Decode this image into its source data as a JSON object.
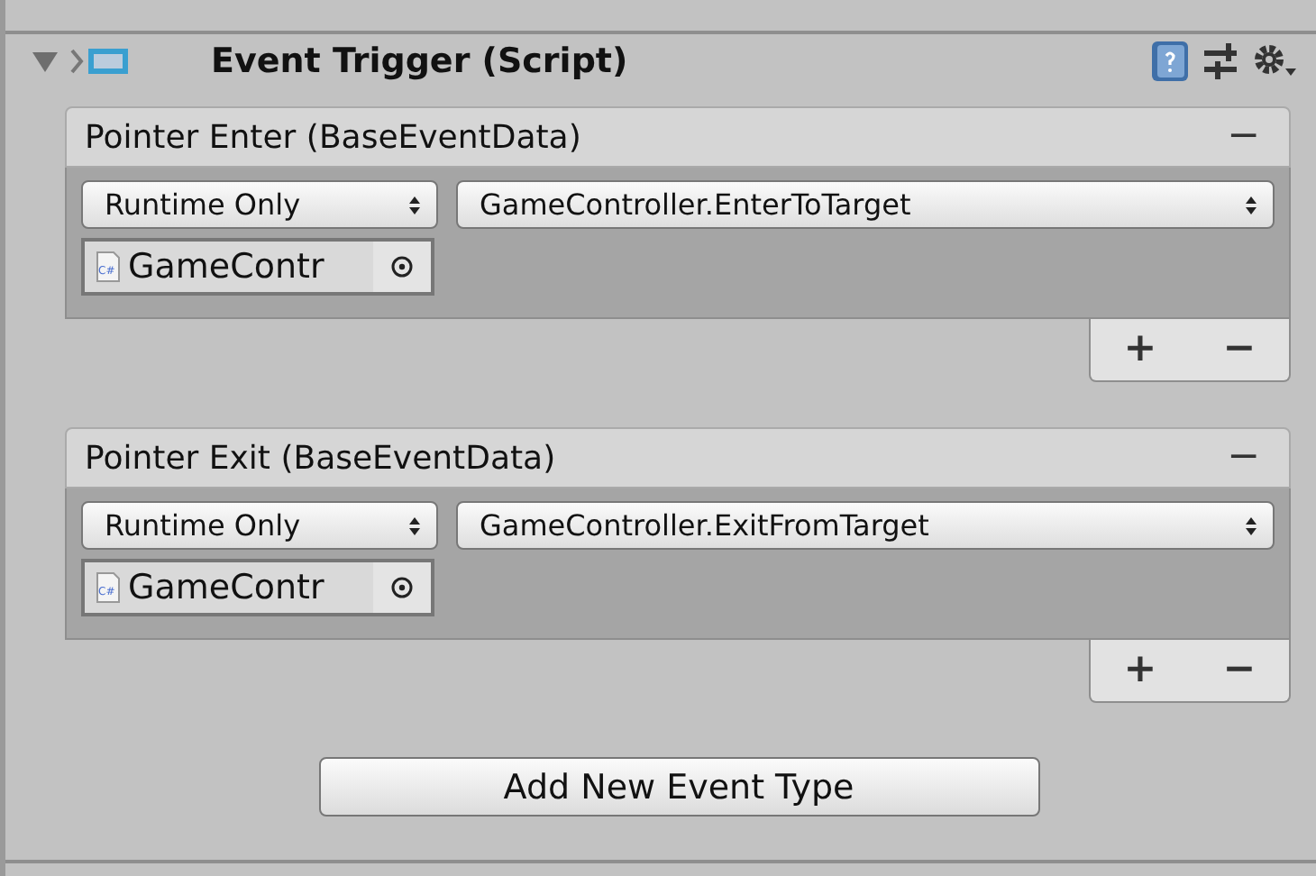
{
  "component": {
    "title": "Event Trigger (Script)",
    "expanded": true
  },
  "events": [
    {
      "title": "Pointer Enter (BaseEventData)",
      "remove": "−",
      "mode": "Runtime Only",
      "function": "GameController.EnterToTarget",
      "object_icon": "C#",
      "object": "GameContr",
      "add": "+",
      "remove_listener": "−"
    },
    {
      "title": "Pointer Exit (BaseEventData)",
      "remove": "−",
      "mode": "Runtime Only",
      "function": "GameController.ExitFromTarget",
      "object_icon": "C#",
      "object": "GameContr",
      "add": "+",
      "remove_listener": "−"
    }
  ],
  "add_button": "Add New Event Type"
}
